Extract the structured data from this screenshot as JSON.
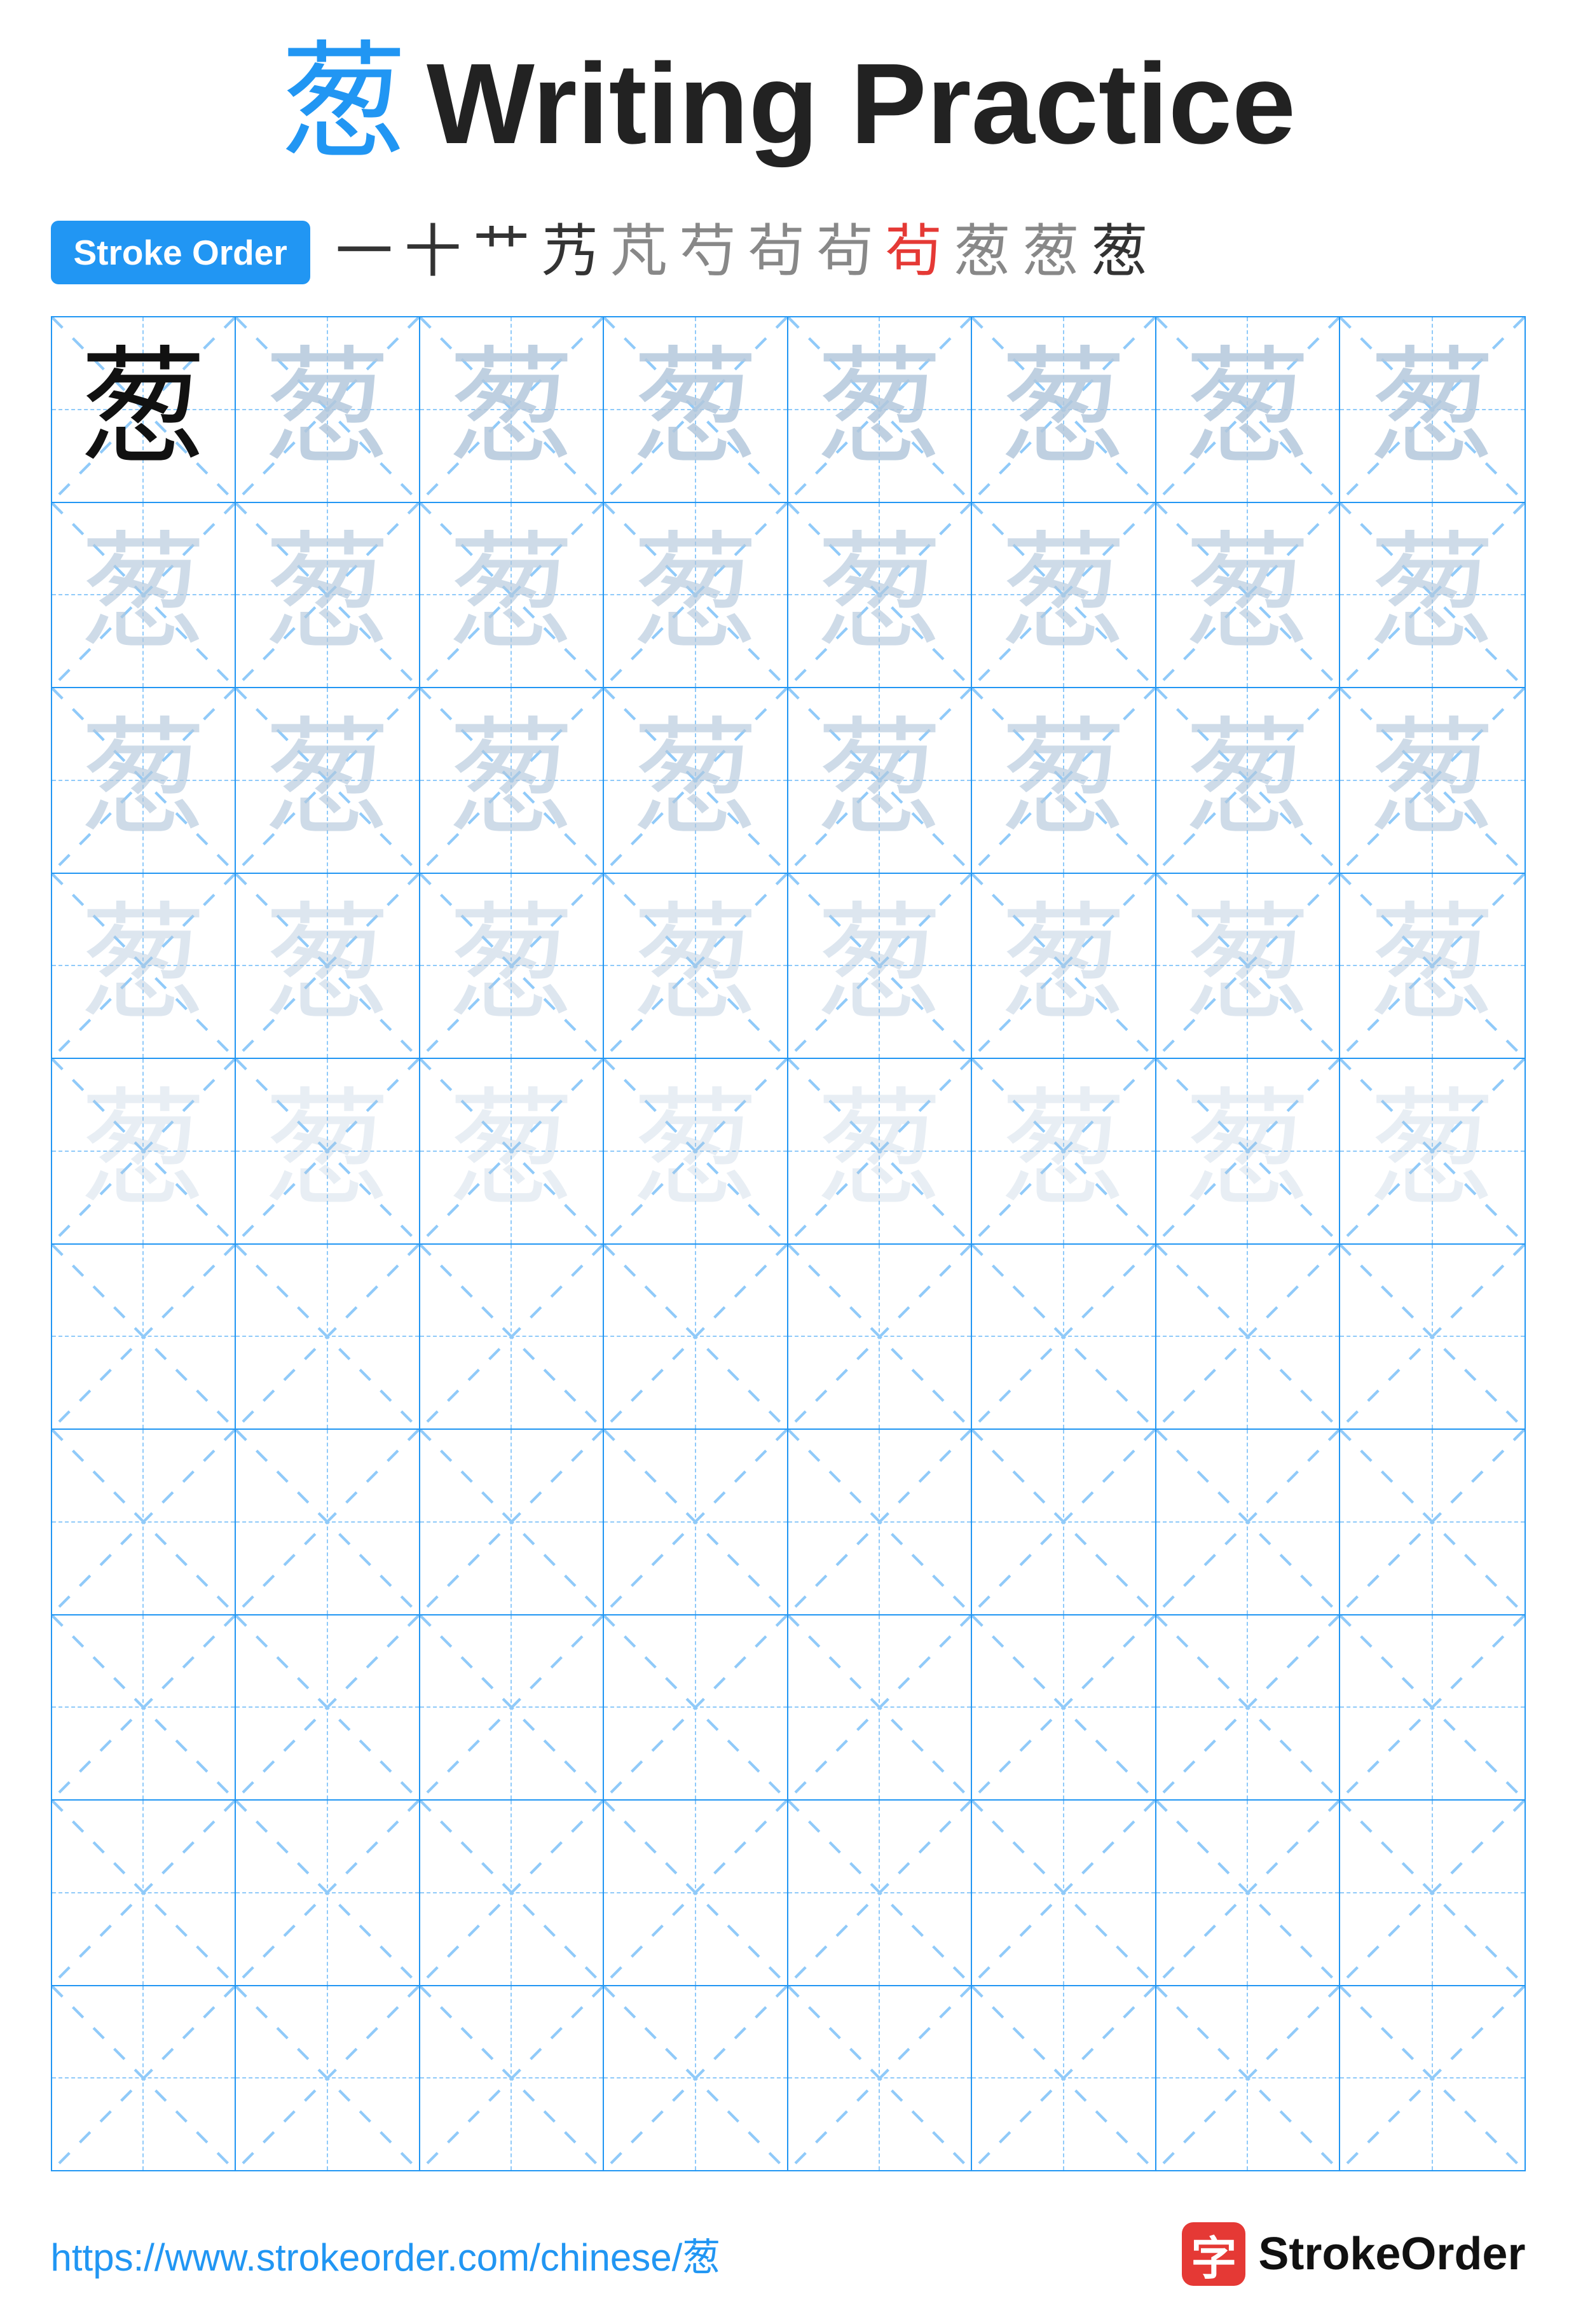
{
  "title": {
    "char": "葱",
    "text": "Writing Practice"
  },
  "stroke_order": {
    "badge_label": "Stroke Order",
    "strokes": [
      "一",
      "十",
      "艹",
      "艿",
      "芃",
      "芍",
      "茍",
      "茍",
      "茍",
      "葱",
      "葱",
      "葱"
    ]
  },
  "practice": {
    "char": "葱",
    "rows": 10,
    "cols": 8
  },
  "footer": {
    "url": "https://www.strokeorder.com/chinese/葱",
    "logo_char": "字",
    "logo_text": "StrokeOrder"
  }
}
